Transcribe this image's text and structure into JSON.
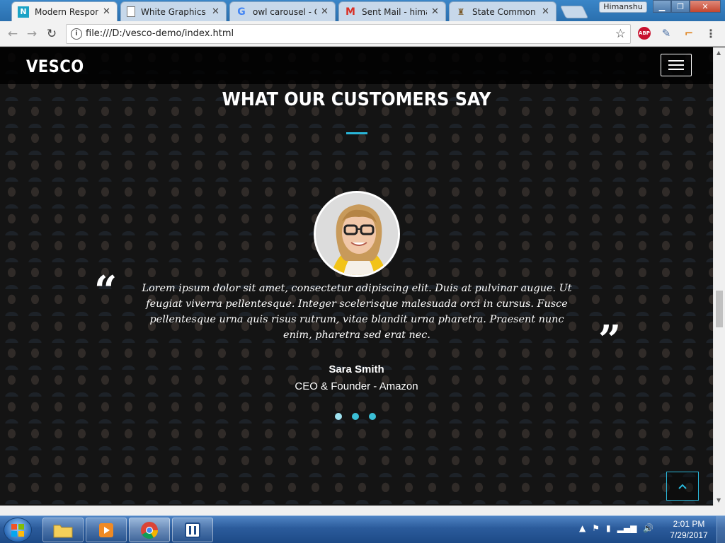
{
  "browser": {
    "tabs": [
      {
        "title": "Modern Responsi",
        "icon": "vesco-icon",
        "active": true
      },
      {
        "title": "White Graphics",
        "icon": "document-icon",
        "active": false
      },
      {
        "title": "owl carousel - Go",
        "icon": "google-icon",
        "active": false
      },
      {
        "title": "Sent Mail - himan",
        "icon": "gmail-icon",
        "active": false
      },
      {
        "title": "State Common En",
        "icon": "emblem-icon",
        "active": false
      }
    ],
    "profile_name": "Himanshu",
    "url": "file:///D:/vesco-demo/index.html",
    "extension_abp": "ABP"
  },
  "page": {
    "brand": "VESCO",
    "section_title": "WHAT OUR CUSTOMERS SAY",
    "quote_open": "“",
    "quote_close": "”",
    "testimonial": "Lorem ipsum dolor sit amet, consectetur adipiscing elit. Duis at pulvinar augue. Ut feugiat viverra pellentesque. Integer scelerisque malesuada orci in cursus. Fusce pellentesque urna quis risus rutrum, vitae blandit urna pharetra. Praesent nunc enim, pharetra sed erat nec.",
    "person_name": "Sara Smith",
    "person_role": "CEO & Founder - Amazon",
    "carousel_dots": 3,
    "carousel_active": 1,
    "accent_color": "#29b6d8"
  },
  "taskbar": {
    "time": "2:01 PM",
    "date": "7/29/2017"
  }
}
